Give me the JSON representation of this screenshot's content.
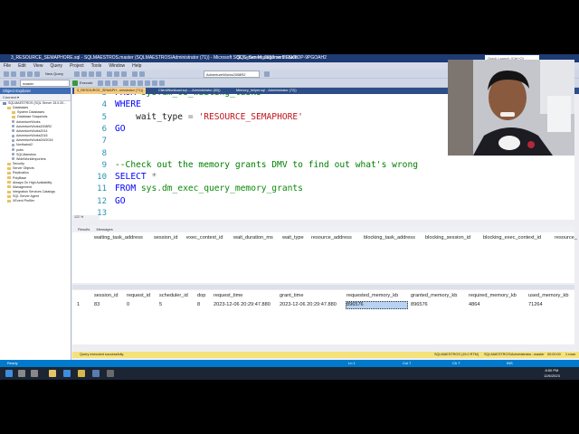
{
  "window": {
    "app_title": "3_RESOURCE_SEMAPHORE.sql - SQLMAESTROS.master (SQLMAESTROS\\Administrator (71)) - Microsoft SQL Server Management Studio",
    "center_title": "SQL_Server_2019 on DESKTOP-9PGOAH2",
    "quick_launch": "Quick Launch (Ctrl+Q)"
  },
  "menu": [
    "File",
    "Edit",
    "View",
    "Query",
    "Project",
    "Tools",
    "Window",
    "Help"
  ],
  "toolbar": {
    "new_query": "New Query",
    "database": "AdventureWorks2008R2",
    "db_select": "master",
    "execute": "Execute"
  },
  "object_explorer": {
    "title": "Object Explorer",
    "connect": "Connect ▾",
    "tree": [
      {
        "label": "SQLMAESTROS (SQL Server 15.0.20...",
        "level": 0,
        "kind": "srv"
      },
      {
        "label": "Databases",
        "level": 1,
        "kind": "folder"
      },
      {
        "label": "System Databases",
        "level": 2,
        "kind": "folder"
      },
      {
        "label": "Database Snapshots",
        "level": 2,
        "kind": "folder"
      },
      {
        "label": "AdventureWorks",
        "level": 2,
        "kind": "db"
      },
      {
        "label": "AdventureWorks2008R2",
        "level": 2,
        "kind": "db"
      },
      {
        "label": "AdventureWorks2014",
        "level": 2,
        "kind": "db"
      },
      {
        "label": "AdventureWorks2016",
        "level": 2,
        "kind": "db"
      },
      {
        "label": "AdventureWorksDW2016",
        "level": 2,
        "kind": "db"
      },
      {
        "label": "Northwind2",
        "level": 2,
        "kind": "db"
      },
      {
        "label": "pubs",
        "level": 2,
        "kind": "db"
      },
      {
        "label": "SQLMaestros",
        "level": 2,
        "kind": "db"
      },
      {
        "label": "WideWorldImporters",
        "level": 2,
        "kind": "db"
      },
      {
        "label": "Security",
        "level": 1,
        "kind": "folder"
      },
      {
        "label": "Server Objects",
        "level": 1,
        "kind": "folder"
      },
      {
        "label": "Replication",
        "level": 1,
        "kind": "folder"
      },
      {
        "label": "PolyBase",
        "level": 1,
        "kind": "folder"
      },
      {
        "label": "Always On High Availability",
        "level": 1,
        "kind": "folder"
      },
      {
        "label": "Management",
        "level": 1,
        "kind": "folder"
      },
      {
        "label": "Integration Services Catalogs",
        "level": 1,
        "kind": "folder"
      },
      {
        "label": "SQL Server Agent",
        "level": 1,
        "kind": "folder"
      },
      {
        "label": "XEvent Profiler",
        "level": 1,
        "kind": "folder"
      }
    ]
  },
  "doc_tabs": [
    {
      "label": "3_RESOURCE_SEMAPH...minstrator (71))",
      "active": true
    },
    {
      "label": "ClientWorkload.sql -...Administrator (80))",
      "active": false
    },
    {
      "label": "Memory_helper.sql - Administrator (72))",
      "active": false
    }
  ],
  "editor": {
    "lines": [
      {
        "n": "3",
        "parts": [
          {
            "t": "FROM ",
            "c": "kw"
          },
          {
            "t": "sys",
            "c": "teal"
          },
          {
            "t": ".",
            "c": "gray"
          },
          {
            "t": "dm_os_waiting_tasks",
            "c": "fn"
          }
        ]
      },
      {
        "n": "4",
        "parts": [
          {
            "t": "WHERE",
            "c": "kw"
          }
        ]
      },
      {
        "n": "5",
        "parts": [
          {
            "t": "    wait_type ",
            "c": ""
          },
          {
            "t": "= ",
            "c": "gray"
          },
          {
            "t": "'RESOURCE_SEMAPHORE'",
            "c": "str"
          }
        ]
      },
      {
        "n": "6",
        "parts": [
          {
            "t": "GO",
            "c": "kw"
          }
        ]
      },
      {
        "n": "7",
        "parts": []
      },
      {
        "n": "8",
        "parts": []
      },
      {
        "n": "9",
        "parts": [
          {
            "t": "--Check out the memory grants DMV to find out what's wrong",
            "c": "cmt"
          }
        ]
      },
      {
        "n": "10",
        "parts": [
          {
            "t": "SELECT ",
            "c": "kw"
          },
          {
            "t": "*",
            "c": "gray"
          }
        ]
      },
      {
        "n": "11",
        "parts": [
          {
            "t": "FROM ",
            "c": "kw"
          },
          {
            "t": "sys",
            "c": "teal"
          },
          {
            "t": ".",
            "c": "gray"
          },
          {
            "t": "dm_exec_query_memory_grants",
            "c": "fn"
          }
        ]
      },
      {
        "n": "12",
        "parts": [
          {
            "t": "GO",
            "c": "kw"
          }
        ]
      },
      {
        "n": "13",
        "parts": []
      }
    ],
    "zoom": "122 %"
  },
  "result_tabs": [
    "Results",
    "Messages"
  ],
  "grid1": {
    "headers": [
      "waiting_task_address",
      "session_id",
      "exec_context_id",
      "wait_duration_ms",
      "wait_type",
      "resource_address",
      "blocking_task_address",
      "blocking_session_id",
      "blocking_exec_context_id",
      "resource_"
    ]
  },
  "grid2": {
    "headers": [
      "session_id",
      "request_id",
      "scheduler_id",
      "dop",
      "request_time",
      "grant_time",
      "requested_memory_kb",
      "granted_memory_kb",
      "required_memory_kb",
      "used_memory_kb"
    ],
    "row_num": "1",
    "row": [
      "83",
      "0",
      "5",
      "8",
      "2023-12-06 20:29:47.880",
      "2023-12-06 20:29:47.880",
      "896576",
      "896576",
      "4864",
      "71264"
    ]
  },
  "query_status": {
    "message": "Query executed successfully.",
    "server": "SQLMAESTROS (15.0 RTM)",
    "user": "SQLMAESTROS\\Administrator...",
    "db": "master",
    "time": "00:00:00",
    "rows": "1 rows"
  },
  "app_status": {
    "ready": "Ready",
    "ln": "Ln 1",
    "col": "Col 7",
    "ch": "Ch 7",
    "ins": "INS"
  },
  "taskbar": {
    "time": "8:50 PM",
    "date": "12/6/2023"
  }
}
